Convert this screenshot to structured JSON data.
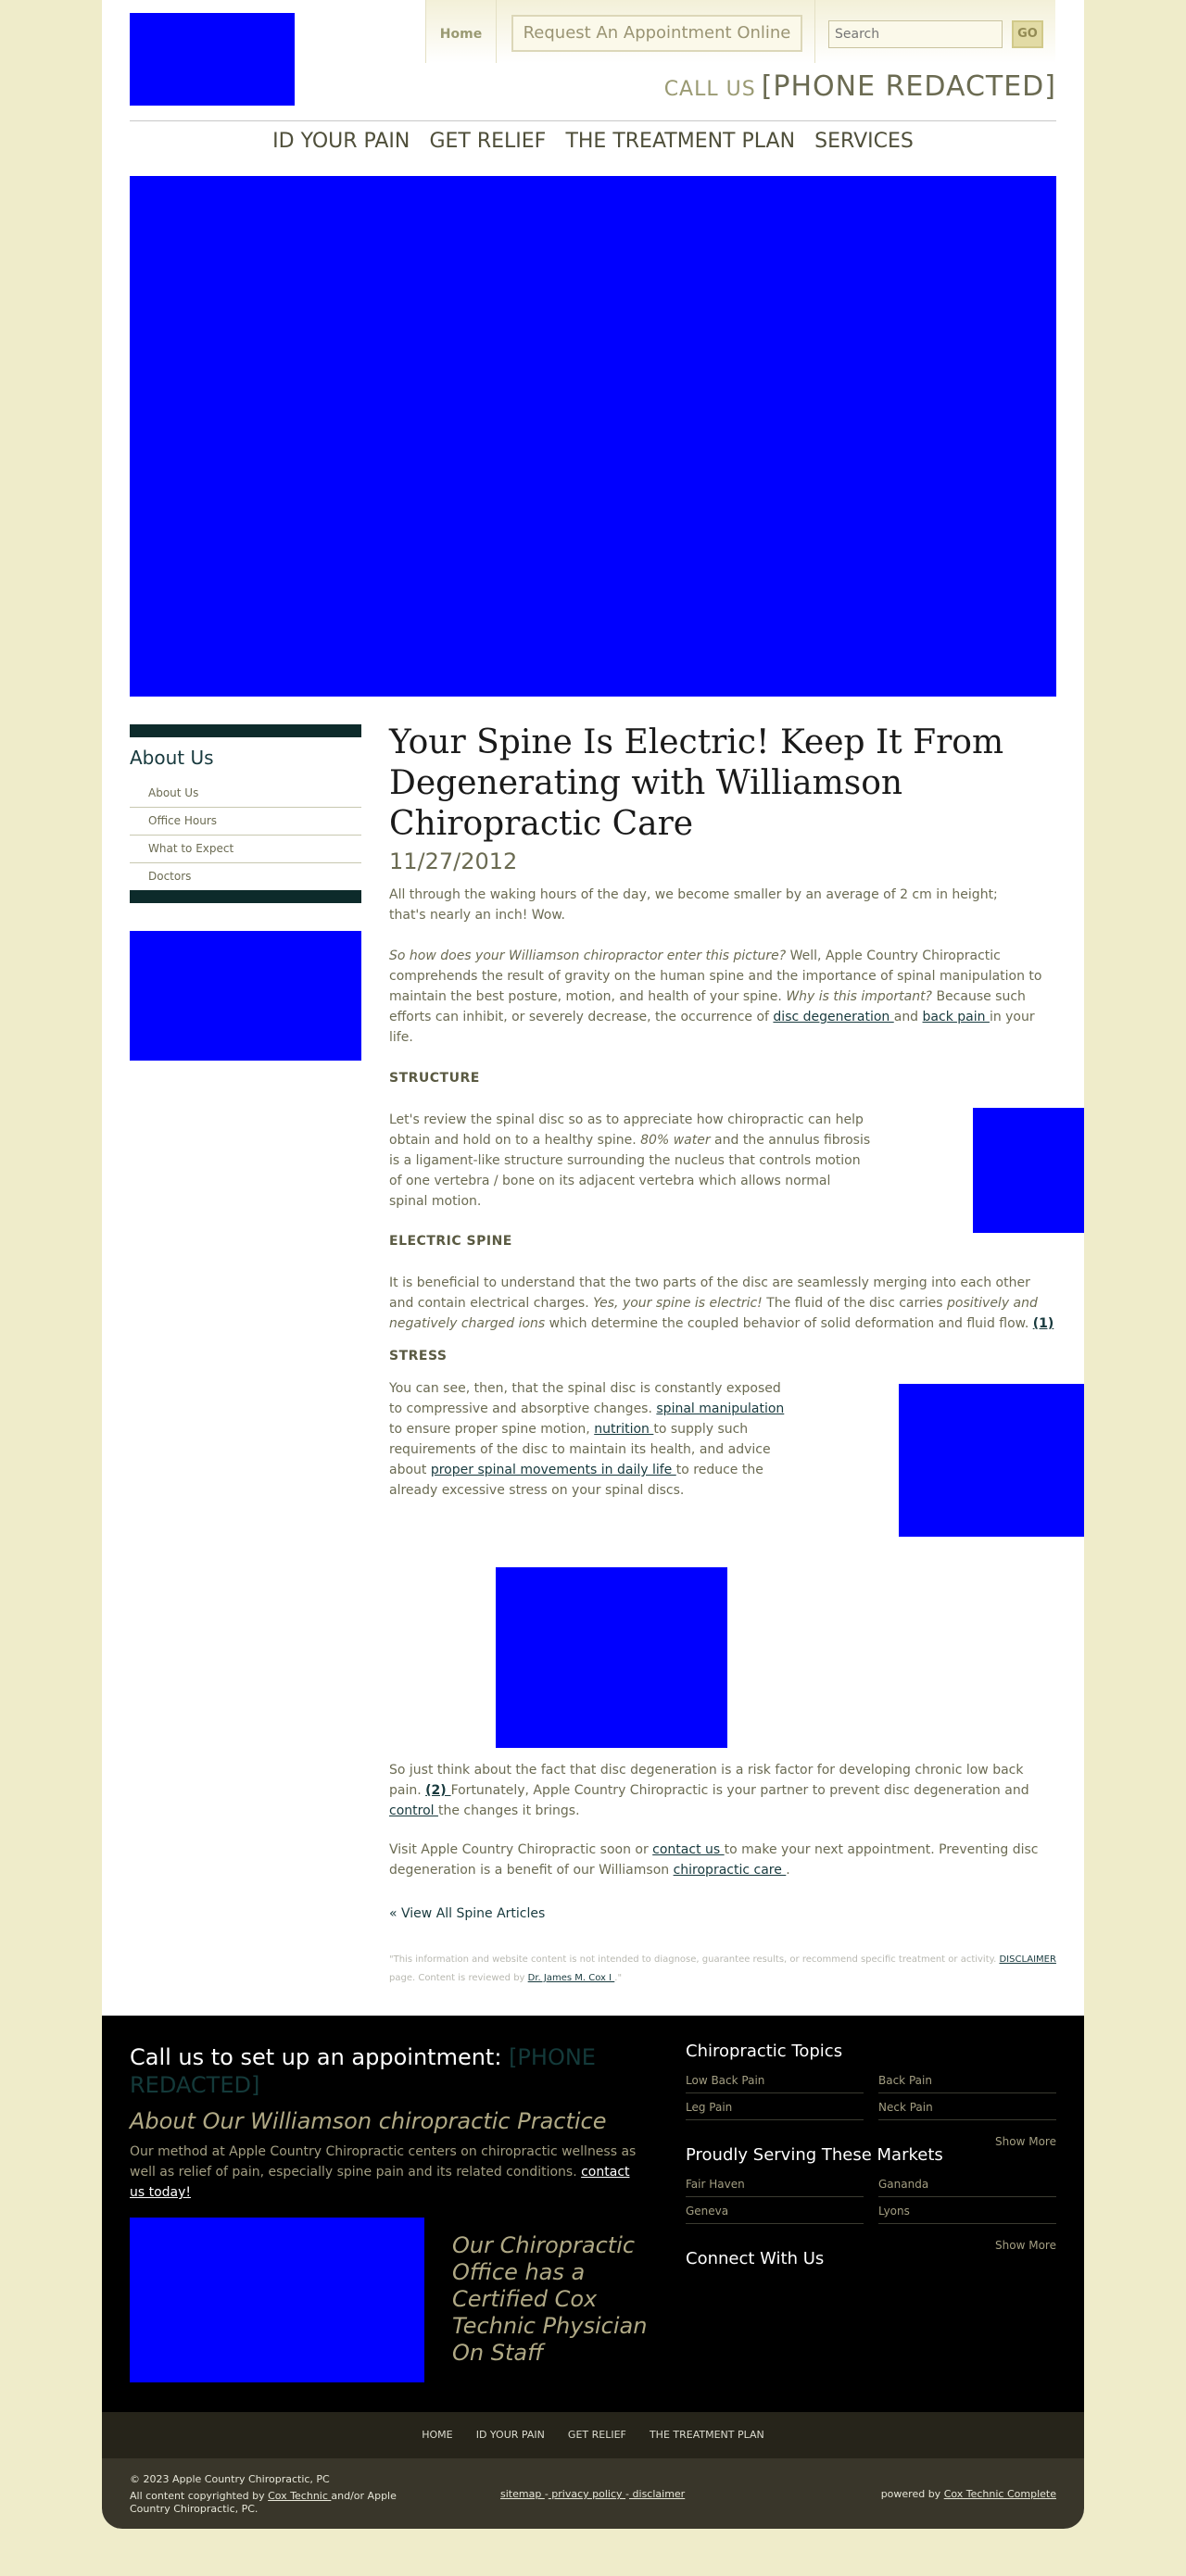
{
  "header": {
    "home": "Home",
    "appointment": "Request An Appointment Online",
    "search_placeholder": "Search",
    "go": "GO",
    "call_label": "CALL US",
    "phone": "[PHONE REDACTED]",
    "nav": [
      "ID YOUR PAIN",
      "GET RELIEF",
      "THE TREATMENT PLAN",
      "SERVICES"
    ]
  },
  "sidebar": {
    "title": "About Us",
    "items": [
      "About Us",
      "Office Hours",
      "What to Expect",
      "Doctors"
    ]
  },
  "article": {
    "title": "Your Spine Is Electric! Keep It From Degenerating with Williamson Chiropractic Care",
    "date": "11/27/2012",
    "p1": "All through the waking hours of the day, we become smaller by an average of 2 cm in height; that's nearly an inch!  Wow.",
    "p2_italic1": "So how does your Williamson chiropractor enter this picture?",
    "p2_text1": " Well, Apple Country Chiropractic comprehends the result of gravity on the human spine and the importance of spinal manipulation to maintain the best posture, motion, and health of your spine. ",
    "p2_italic2": "Why is this important?",
    "p2_text2": " Because such efforts can inhibit, or severely decrease, the occurrence of ",
    "p2_link1": "disc degeneration ",
    "p2_and": "and ",
    "p2_link2": "back pain ",
    "p2_end": "in your life.",
    "h_structure": "STRUCTURE",
    "p3_text1": "Let's review the spinal disc so as to appreciate how chiropractic can help obtain and hold on to a healthy spine. ",
    "p3_italic": "80% water",
    "p3_text2": " and the annulus fibrosis is a ligament-like structure surrounding the nucleus that controls motion of one vertebra / bone on its adjacent vertebra which allows normal spinal motion.",
    "h_electric": "ELECTRIC SPINE",
    "p4_text1": "It is beneficial to understand that the two parts of the disc are seamlessly merging into each other and contain electrical charges. ",
    "p4_italic1": "Yes, your spine is electric!",
    "p4_text2": " The fluid of the disc carries ",
    "p4_italic2": "positively and negatively charged ions",
    "p4_text3": " which determine the coupled behavior of solid deformation and fluid flow. ",
    "p4_ref": "(1)",
    "h_stress": "STRESS",
    "p5_text1": "You can see, then, that the spinal disc is constantly exposed to compressive and absorptive changes. ",
    "p5_link1": "spinal manipulation",
    "p5_text2": " to ensure proper spine motion,  ",
    "p5_link2": "nutrition ",
    "p5_text3": "to supply such requirements of the disc to maintain its health, and advice about  ",
    "p5_link3": "proper spinal movements in daily life ",
    "p5_text4": "to reduce the already excessive stress on your spinal discs.",
    "p6_text1": "So just think about the fact that disc degeneration is a risk factor for developing chronic low back pain.  ",
    "p6_ref": "(2) ",
    "p6_text2": "Fortunately, Apple Country Chiropractic is your partner to prevent disc degeneration and ",
    "p6_link": "control ",
    "p6_text3": "the changes it brings.",
    "p7_text1": "Visit Apple Country Chiropractic soon or  ",
    "p7_link1": "contact us ",
    "p7_text2": "to make your next appointment. Preventing disc degeneration is a benefit of our Williamson ",
    "p7_link2": "chiropractic care ",
    "p7_text3": ".",
    "view_all": "« View All Spine Articles",
    "disclaimer_text": "\"This information and website content is not intended to diagnose, guarantee results, or recommend specific treatment or activity. ",
    "disclaimer_link": "DISCLAIMER",
    "disclaimer_text2": " page. Content is reviewed by ",
    "reviewer_link": "Dr. James M. Cox I ",
    "disclaimer_end": ".\""
  },
  "footer": {
    "call_text": "Call us to set up an appointment: ",
    "phone": "[PHONE REDACTED]",
    "about_title": "About Our Williamson chiropractic Practice",
    "about_text": "Our method at Apple Country Chiropractic centers on chiropractic wellness as well as relief of pain, especially spine pain and its related conditions. ",
    "about_link": "contact us today!",
    "cert": "Our Chiropractic Office has a Certified Cox Technic Physician On Staff",
    "topics_title": "Chiropractic Topics",
    "topics": [
      "Low Back Pain",
      "Back Pain",
      "Leg Pain",
      "Neck Pain"
    ],
    "show_more": "Show More",
    "markets_title": "Proudly Serving These Markets",
    "markets": [
      "Fair Haven",
      "Gananda",
      "Geneva",
      "Lyons"
    ],
    "connect_title": "Connect With Us",
    "nav": [
      "HOME",
      "ID YOUR PAIN",
      "GET RELIEF",
      "THE TREATMENT PLAN"
    ],
    "copyright1": "© 2023 Apple Country Chiropractic, PC",
    "copyright2": "All content copyrighted by ",
    "copyright_link": "Cox Technic ",
    "copyright3": "and/or Apple Country Chiropractic, PC.",
    "sitemap": "sitemap ",
    "privacy": " privacy policy ",
    "disclaimer": " disclaimer",
    "sep": "-",
    "powered_text": "powered by ",
    "powered_link": "Cox Technic Complete"
  }
}
